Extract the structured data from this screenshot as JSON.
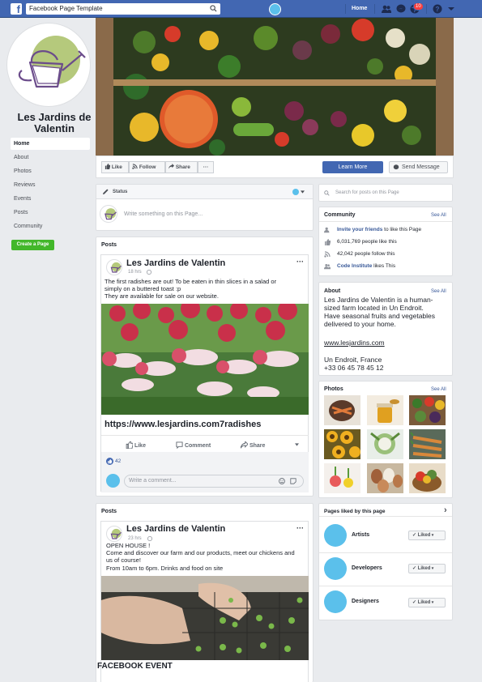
{
  "topbar": {
    "logo": "f",
    "search_value": "Facebook Page Template",
    "home_label": "Home",
    "notification_count": "10",
    "icons": [
      "search-icon",
      "friends-icon",
      "messenger-icon",
      "globe-icon",
      "help-icon",
      "caret-icon"
    ]
  },
  "sidebar": {
    "page_name": "Les Jardins de Valentin",
    "items": [
      {
        "label": "Home",
        "active": true
      },
      {
        "label": "About"
      },
      {
        "label": "Photos"
      },
      {
        "label": "Reviews"
      },
      {
        "label": "Events"
      },
      {
        "label": "Posts"
      },
      {
        "label": "Community"
      }
    ],
    "create_page_label": "Create a Page"
  },
  "actions": {
    "like_label": "Like",
    "follow_label": "Follow",
    "share_label": "Share",
    "more_label": "···",
    "learn_more_label": "Learn More",
    "send_message_label": "Send Message"
  },
  "composer": {
    "tab_label": "Status",
    "placeholder": "Write something on this Page..."
  },
  "posts": [
    {
      "section_title": "Posts",
      "author": "Les Jardins de Valentin",
      "time": "18 hrs",
      "text_lines": [
        "The first radishes are out! To be eaten in thin slices in a salad or",
        "simply on a buttered toast :p",
        "They are available for sale on our website."
      ],
      "link": "https://www.lesjardins.com7radishes",
      "like_label": "Like",
      "comment_label": "Comment",
      "share_label": "Share",
      "reactions": "42",
      "comment_placeholder": "Write a comment..."
    },
    {
      "section_title": "Posts",
      "author": "Les Jardins de Valentin",
      "time": "23 hrs",
      "text_lines": [
        "OPEN HOUSE !",
        "Come and discover our farm and our products, meet our chickens and",
        "us of course!",
        "From 10am to 6pm. Drinks and food on site"
      ],
      "caption": "FACEBOOK EVENT"
    }
  ],
  "right": {
    "search_placeholder": "Search for posts on this Page",
    "community": {
      "title": "Community",
      "see_all": "See All",
      "invite_link": "Invite your friends",
      "invite_rest": " to like this Page",
      "likes": "6,031,769 people like this",
      "follows": "42,042 people follow this",
      "liker_name": "Code Institute",
      "liker_rest": " likes This"
    },
    "about": {
      "title": "About",
      "see_all": "See All",
      "lines": [
        "Les Jardins de Valentin is a human-",
        "sized farm located in Un Endroit.",
        "Have seasonal fruits and vegetables",
        "delivered to your home."
      ],
      "website": "www.lesjardins.com",
      "location": "Un Endroit, France",
      "phone": "+33 06 45 78 45 12"
    },
    "photos": {
      "title": "Photos",
      "see_all": "See All"
    },
    "pages_liked": {
      "title": "Pages liked by this page",
      "chevron": "›",
      "items": [
        {
          "name": "Artists",
          "button": "Liked"
        },
        {
          "name": "Developers",
          "button": "Liked"
        },
        {
          "name": "Designers",
          "button": "Liked"
        }
      ]
    }
  },
  "colors": {
    "brand_blue": "#4267b2",
    "accent_cyan": "#5bc0eb",
    "create_green": "#42b72a",
    "logo_green": "#b5c97c",
    "logo_purple": "#6b4c8b"
  }
}
